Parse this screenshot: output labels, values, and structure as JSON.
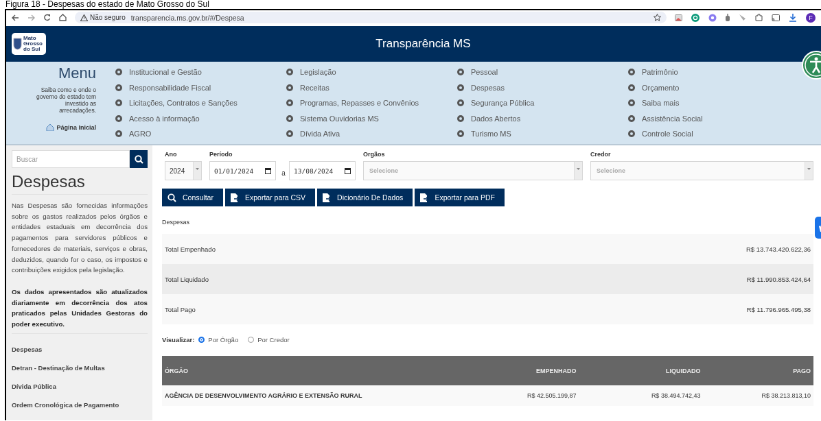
{
  "caption": "Figura 18 - Despesas do estado de Mato Grosso do Sul",
  "browser": {
    "security": "Não seguro",
    "url": "transparencia.ms.gov.br/#/Despesa",
    "profile": "F"
  },
  "header": {
    "logo_text": "Mato Grosso do Sul",
    "title": "Transparência MS"
  },
  "menu": {
    "title": "Menu",
    "description": "Saiba como e onde o governo do estado tem investido as arrecadações.",
    "home_link": "Página Inicial",
    "columns": [
      [
        "Institucional e Gestão",
        "Responsabilidade Fiscal",
        "Licitações, Contratos e Sanções",
        "Acesso à informação",
        "AGRO"
      ],
      [
        "Legislação",
        "Receitas",
        "Programas, Repasses e Convênios",
        "Sistema Ouvidorias MS",
        "Dívida Ativa"
      ],
      [
        "Pessoal",
        "Despesas",
        "Segurança Pública",
        "Dados Abertos",
        "Turismo MS"
      ],
      [
        "Patrimônio",
        "Orçamento",
        "Saiba mais",
        "Assistência Social",
        "Controle Social"
      ]
    ]
  },
  "sidebar": {
    "search_placeholder": "Buscar",
    "title": "Despesas",
    "intro": "Nas Despesas são fornecidas informações sobre os gastos realizados pelos órgãos e entidades estaduais em decorrência dos pagamentos para servidores públicos e fornecedores de materiais, serviços e obras, deduzidos, quando for o caso, os impostos e contribuições exigidos pela legislação.",
    "notice": "Os dados apresentados são atualizados diariamente em decorrência dos atos praticados pelas Unidades Gestoras do poder executivo.",
    "links": [
      "Despesas",
      "Detran - Destinação de Multas",
      "Dívida Pública",
      "Ordem Cronológica de Pagamento"
    ]
  },
  "filters": {
    "year": {
      "label": "Ano",
      "value": "2024"
    },
    "period": {
      "label": "Período",
      "start": "01/01/2024",
      "separator": "a",
      "end": "13/08/2024"
    },
    "orgaos": {
      "label": "Orgãos",
      "placeholder": "Selecione"
    },
    "credor": {
      "label": "Credor",
      "placeholder": "Selecione"
    }
  },
  "actions": [
    {
      "label": "Consultar",
      "kind": "search"
    },
    {
      "label": "Exportar para CSV",
      "kind": "export"
    },
    {
      "label": "Dicionário De Dados",
      "kind": "export"
    },
    {
      "label": "Exportar para PDF",
      "kind": "export"
    }
  ],
  "summary": {
    "title": "Despesas",
    "rows": [
      {
        "label": "Total Empenhado",
        "value": "R$ 13.743.420.622,36"
      },
      {
        "label": "Total Liquidado",
        "value": "R$ 11.990.853.424,64"
      },
      {
        "label": "Total Pago",
        "value": "R$ 11.796.965.495,38"
      }
    ]
  },
  "view": {
    "label": "Visualizar:",
    "options": [
      {
        "label": "Por Órgão",
        "selected": true
      },
      {
        "label": "Por Credor",
        "selected": false
      }
    ]
  },
  "table": {
    "columns": [
      "ÓRGÃO",
      "EMPENHADO",
      "LIQUIDADO",
      "PAGO"
    ],
    "rows": [
      [
        "AGÊNCIA DE DESENVOLVIMENTO AGRÁRIO E EXTENSÃO RURAL",
        "R$ 42.505.199,87",
        "R$ 38.494.742,43",
        "R$ 38.213.813,10"
      ]
    ]
  }
}
